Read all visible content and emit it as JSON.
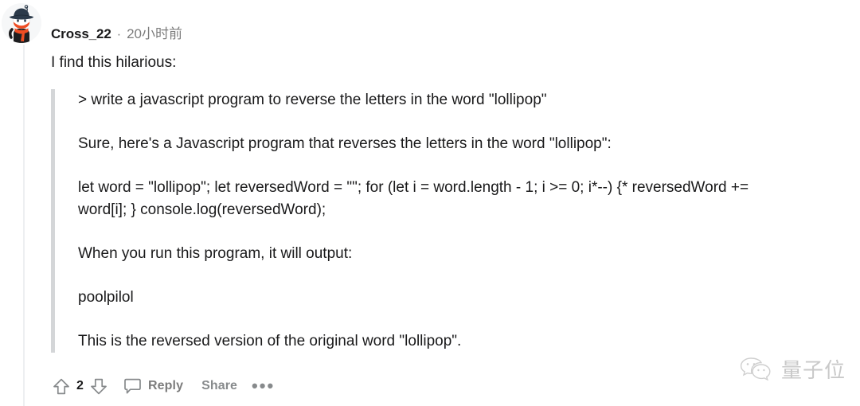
{
  "comment": {
    "author": "Cross_22",
    "separator": "·",
    "timestamp": "20小时前",
    "lead_text": "I find this hilarious:",
    "quote_paragraphs": [
      "> write a javascript program to reverse the letters in the word \"lollipop\"",
      "Sure, here's a Javascript program that reverses the letters in the word \"lollipop\":",
      "let word = \"lollipop\"; let reversedWord = \"\"; for (let i = word.length - 1; i >= 0; i*--) {* reversedWord += word[i]; } console.log(reversedWord);",
      "When you run this program, it will output:",
      "poolpilol",
      "This is the reversed version of the original word \"lollipop\"."
    ]
  },
  "actions": {
    "upvote_icon": "arrow-up-icon",
    "vote_count": "2",
    "downvote_icon": "arrow-down-icon",
    "comment_icon": "speech-bubble-icon",
    "reply_label": "Reply",
    "share_label": "Share",
    "more_label": "•••"
  },
  "watermark": {
    "icon": "wechat-icon",
    "text": "量子位"
  },
  "colors": {
    "text": "#1a1a1b",
    "muted": "#7c7c7c",
    "quote_bar": "#d4d6d8",
    "thread_line": "#edeff1",
    "watermark": "#c9c9c9",
    "avatar_hat": "#2b3a4a",
    "avatar_scarf": "#ef4d23"
  }
}
